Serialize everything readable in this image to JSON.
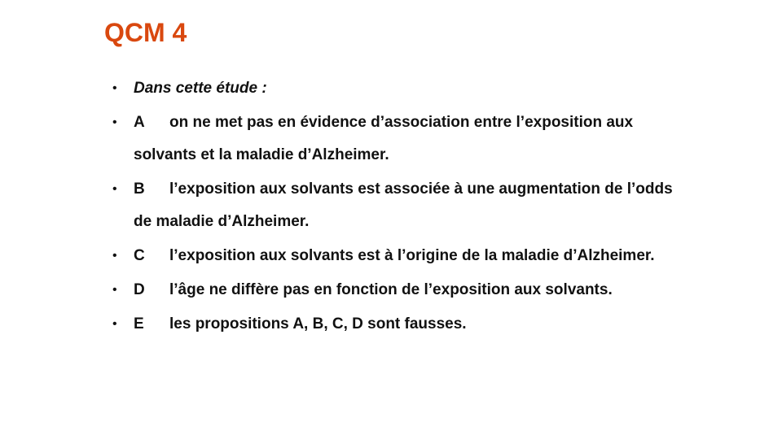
{
  "title": "QCM 4",
  "colors": {
    "title": "#d9480f",
    "text": "#111111"
  },
  "intro": "Dans cette étude :",
  "options": [
    {
      "letter": "A",
      "text": "on ne met pas en évidence d’association entre l’exposition aux solvants et la maladie d’Alzheimer."
    },
    {
      "letter": "B",
      "text": "l’exposition aux solvants est associée à une augmentation de l’odds de maladie d’Alzheimer."
    },
    {
      "letter": "C",
      "text": "l’exposition aux solvants est à l’origine de la maladie d’Alzheimer."
    },
    {
      "letter": "D",
      "text": "l’âge ne diffère pas en fonction de l’exposition aux solvants."
    },
    {
      "letter": "E",
      "text": "les propositions A, B, C, D sont fausses."
    }
  ]
}
